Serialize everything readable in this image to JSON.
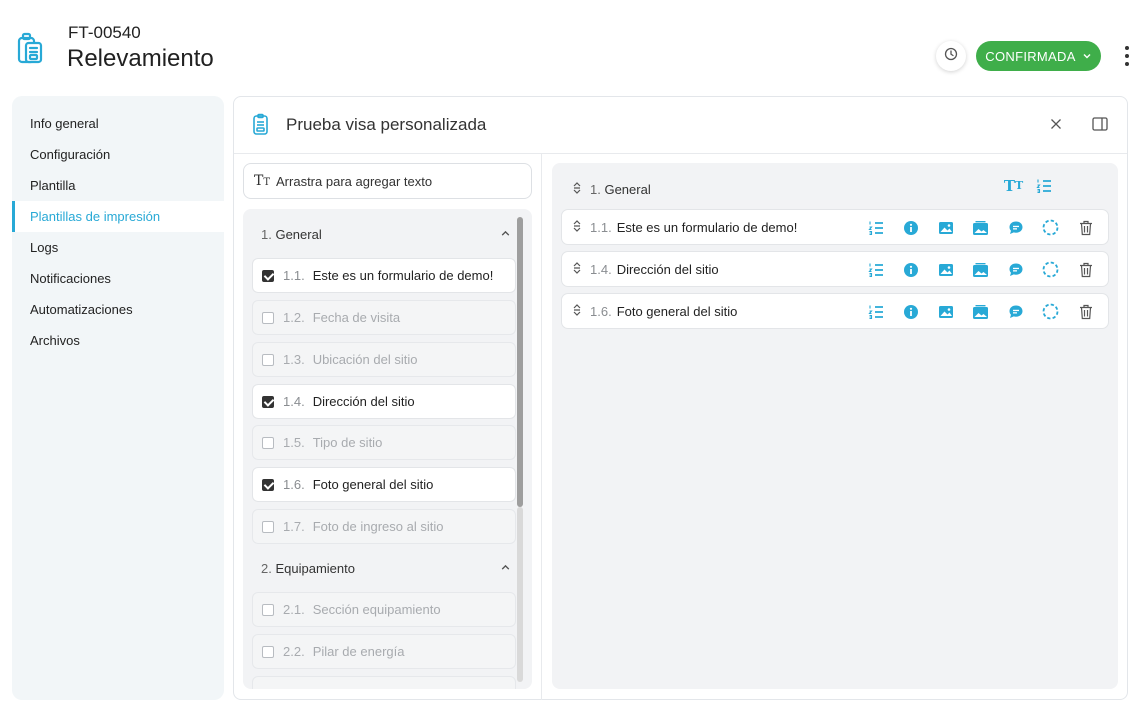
{
  "header": {
    "record_id": "FT-00540",
    "title": "Relevamiento",
    "status": "CONFIRMADA",
    "accent": "#28a9d6",
    "status_color": "#3fae4a"
  },
  "sidebar": {
    "items": [
      {
        "label": "Info general",
        "active": false
      },
      {
        "label": "Configuración",
        "active": false
      },
      {
        "label": "Plantilla",
        "active": false
      },
      {
        "label": "Plantillas de impresión",
        "active": true
      },
      {
        "label": "Logs",
        "active": false
      },
      {
        "label": "Notificaciones",
        "active": false
      },
      {
        "label": "Automatizaciones",
        "active": false
      },
      {
        "label": "Archivos",
        "active": false
      }
    ]
  },
  "panel": {
    "title": "Prueba visa personalizada",
    "drag_text_label": "Arrastra para agregar texto",
    "sections": [
      {
        "num": "1.",
        "name": "General",
        "items": [
          {
            "num": "1.1.",
            "label": "Este es un formulario de demo!",
            "checked": true
          },
          {
            "num": "1.2.",
            "label": "Fecha de visita",
            "checked": false
          },
          {
            "num": "1.3.",
            "label": "Ubicación del sitio",
            "checked": false
          },
          {
            "num": "1.4.",
            "label": "Dirección del sitio",
            "checked": true
          },
          {
            "num": "1.5.",
            "label": "Tipo de sitio",
            "checked": false
          },
          {
            "num": "1.6.",
            "label": "Foto general del sitio",
            "checked": true
          },
          {
            "num": "1.7.",
            "label": "Foto de ingreso al sitio",
            "checked": false
          }
        ]
      },
      {
        "num": "2.",
        "name": "Equipamiento",
        "items": [
          {
            "num": "2.1.",
            "label": "Sección equipamiento",
            "checked": false
          },
          {
            "num": "2.2.",
            "label": "Pilar de energía",
            "checked": false
          }
        ]
      }
    ],
    "selected": {
      "section_num": "1.",
      "section_name": "General",
      "rows": [
        {
          "num": "1.1.",
          "label": "Este es un formulario de demo!"
        },
        {
          "num": "1.4.",
          "label": "Dirección del sitio"
        },
        {
          "num": "1.6.",
          "label": "Foto general del sitio"
        }
      ],
      "row_icons": [
        "numbered-list-icon",
        "info-icon",
        "image-icon",
        "gallery-icon",
        "comment-icon",
        "dashed-circle-icon",
        "trash-icon"
      ]
    }
  }
}
